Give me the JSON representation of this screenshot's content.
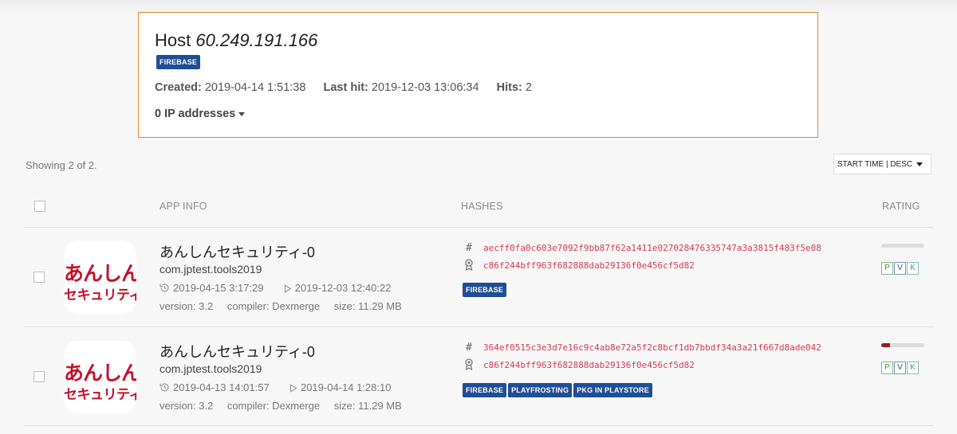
{
  "host": {
    "title_prefix": "Host",
    "ip": "60.249.191.166",
    "badge": "FIREBASE",
    "created_label": "Created:",
    "created_value": "2019-04-14 1:51:38",
    "last_hit_label": "Last hit:",
    "last_hit_value": "2019-12-03 13:06:34",
    "hits_label": "Hits:",
    "hits_value": "2",
    "ip_addresses_toggle": "0 IP addresses"
  },
  "list": {
    "showing": "Showing 2 of 2.",
    "sort_value": "START TIME | DESC",
    "columns": {
      "app_info": "APP INFO",
      "hashes": "HASHES",
      "rating": "RATING"
    }
  },
  "apps": [
    {
      "icon_text_line1": "あんしん",
      "icon_text_line2": "セキュリティ",
      "name": "あんしんセキュリティ-0",
      "package": "com.jptest.tools2019",
      "first_seen": "2019-04-15 3:17:29",
      "last_seen": "2019-12-03 12:40:22",
      "version": "version: 3.2",
      "compiler": "compiler: Dexmerge",
      "size": "size: 11.29 MB",
      "hash_main": "aecff0fa0c603e7092f9bb87f62a1411e027028476335747a3a3815f483f5e08",
      "hash_cert": "c86f244bff963f682888dab29136f0e456cf5d82",
      "badges": [
        "FIREBASE"
      ],
      "rating_fraction": 0.0,
      "pvk": [
        "P",
        "V",
        "K"
      ]
    },
    {
      "icon_text_line1": "あんしん",
      "icon_text_line2": "セキュリティ",
      "name": "あんしんセキュリティ-0",
      "package": "com.jptest.tools2019",
      "first_seen": "2019-04-13 14:01:57",
      "last_seen": "2019-04-14 1:28:10",
      "version": "version: 3.2",
      "compiler": "compiler: Dexmerge",
      "size": "size: 11.29 MB",
      "hash_main": "364ef0515c3e3d7e16c9c4ab8e72a5f2c8bcf1db7bbdf34a3a21f667d8ade042",
      "hash_cert": "c86f244bff963f682888dab29136f0e456cf5d82",
      "badges": [
        "FIREBASE",
        "PLAYFROSTING",
        "PKG IN PLAYSTORE"
      ],
      "rating_fraction": 0.2,
      "pvk": [
        "P",
        "V",
        "K"
      ]
    }
  ],
  "icons": {
    "first_seen": "history-icon",
    "last_seen": "play-icon",
    "hash": "hash-icon",
    "certificate": "certificate-icon",
    "dropdown": "caret-down-icon"
  },
  "colors": {
    "card_border": "#e8822e",
    "badge_bg": "#1f4e96",
    "hash_text": "#d23c55",
    "rating_fill": "#9b1a1a"
  }
}
